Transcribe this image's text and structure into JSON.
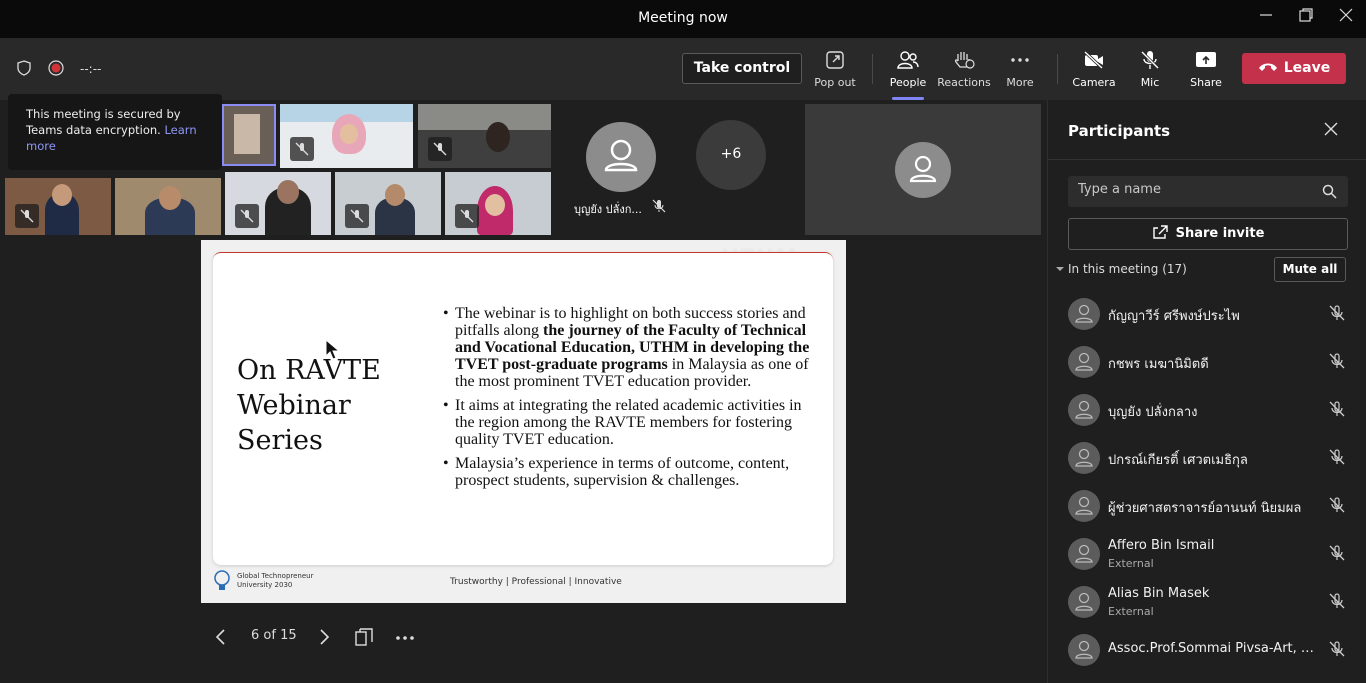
{
  "window": {
    "title": "Meeting now"
  },
  "toolbar": {
    "timer": "--:--",
    "take_control": "Take control",
    "pop_out": "Pop out",
    "people": "People",
    "reactions": "Reactions",
    "more": "More",
    "camera": "Camera",
    "mic": "Mic",
    "share": "Share",
    "leave": "Leave"
  },
  "tooltip": {
    "text": "This meeting is secured by Teams data encryption.",
    "link": "Learn more"
  },
  "video": {
    "named_tile": "บุญยัง ปลั่งก...",
    "overflow": "+6"
  },
  "slide": {
    "title_lines": [
      "On RAVTE",
      "Webinar",
      "Series"
    ],
    "bullet1_a": "The webinar is to highlight on both success stories and pitfalls along ",
    "bullet1_b": "the journey of the Faculty of Technical and Vocational Education, UTHM in developing the TVET post-graduate programs",
    "bullet1_c": " in Malaysia as one of the most prominent TVET education provider.",
    "bullet2": "It aims at integrating the related academic activities in the region among the RAVTE members for fostering quality TVET education.",
    "bullet3": "Malaysia’s experience in terms of outcome, content, prospect students, supervision & challenges.",
    "footer_left_1": "Global Technopreneur",
    "footer_left_2": "University 2030",
    "footer_mid": "Trustworthy | Professional | Innovative",
    "watermark": "UTHM"
  },
  "slide_nav": {
    "page": "6 of 15"
  },
  "panel": {
    "title": "Participants",
    "search_placeholder": "Type a name",
    "share_invite": "Share invite",
    "section": "In this meeting (17)",
    "mute_all": "Mute all",
    "participants": [
      {
        "name": "กัญญาวีร์ ศรีพงษ์ประไพ",
        "sub": ""
      },
      {
        "name": "กชพร เมฆานิมิตดี",
        "sub": ""
      },
      {
        "name": "บุญยัง ปลั่งกลาง",
        "sub": ""
      },
      {
        "name": "ปกรณ์เกียรติ์ เศวตเมธิกุล",
        "sub": ""
      },
      {
        "name": "ผู้ช่วยศาสตราจารย์อานนท์ นิยมผล",
        "sub": ""
      },
      {
        "name": "Affero Bin Ismail",
        "sub": "External"
      },
      {
        "name": "Alias Bin Masek",
        "sub": "External"
      },
      {
        "name": "Assoc.Prof.Sommai Pivsa-Art, Ph...",
        "sub": ""
      }
    ]
  }
}
